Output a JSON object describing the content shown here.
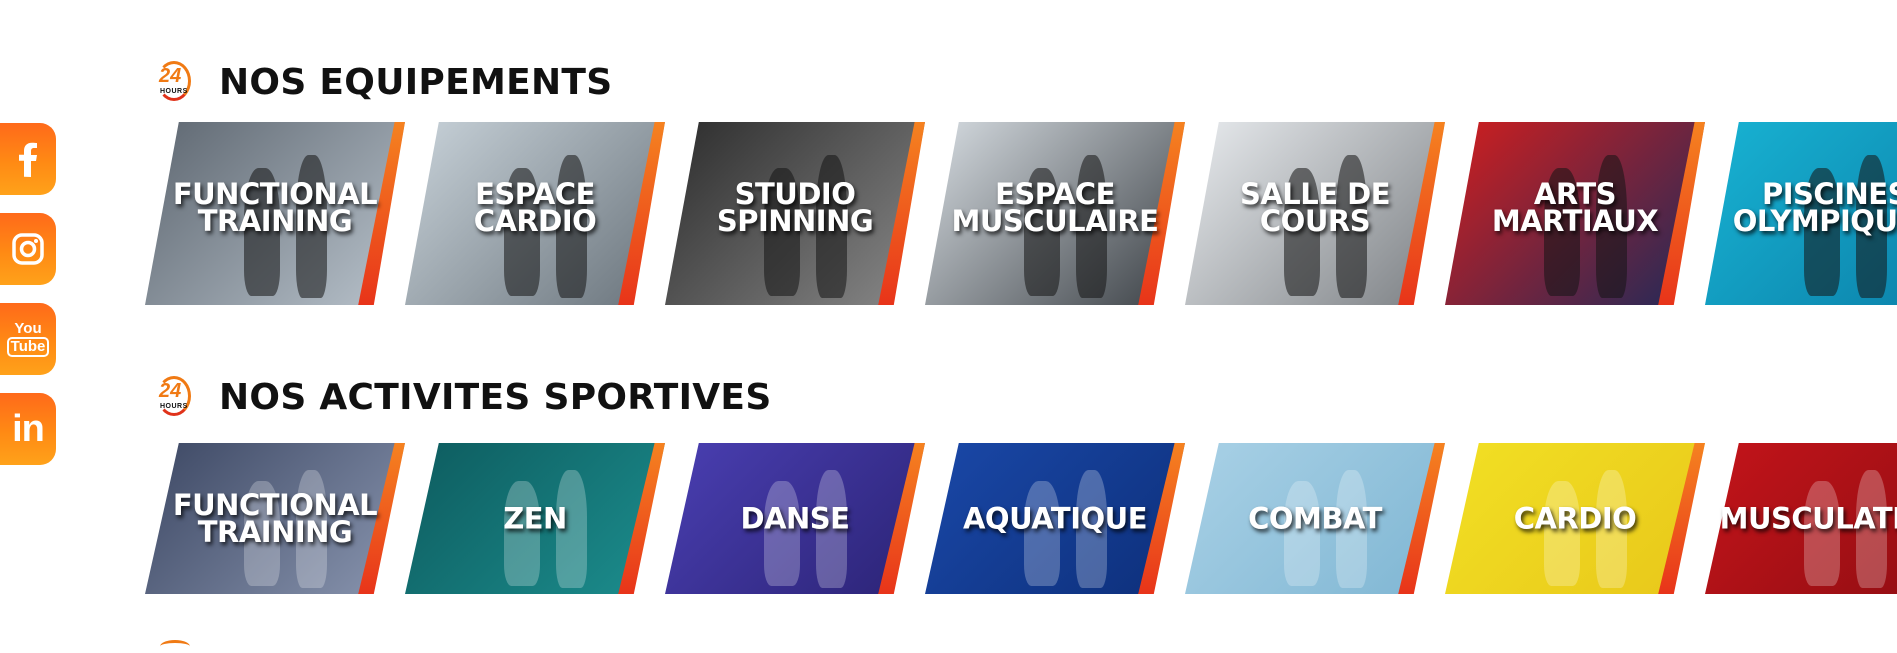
{
  "social": [
    {
      "name": "facebook-icon",
      "glyph": "f"
    },
    {
      "name": "instagram-icon",
      "glyph": ""
    },
    {
      "name": "youtube-icon",
      "glyph_top": "You",
      "glyph_bottom": "Tube"
    },
    {
      "name": "linkedin-icon",
      "glyph": "in"
    }
  ],
  "logo": {
    "number": "24",
    "hours": "HOURS"
  },
  "sections": [
    {
      "title": "NOS EQUIPEMENTS",
      "tiles": [
        {
          "label": "FUNCTIONAL\nTRAINING",
          "bg": "#5d6670",
          "bg2": "#b9c3cc"
        },
        {
          "label": "ESPACE\nCARDIO",
          "bg": "#c9d3da",
          "bg2": "#69737b"
        },
        {
          "label": "STUDIO\nSPINNING",
          "bg": "#2b2b2b",
          "bg2": "#8a8a8a"
        },
        {
          "label": "ESPACE\nMUSCULAIRE",
          "bg": "#d8dee3",
          "bg2": "#3a3f44"
        },
        {
          "label": "SALLE DE\nCOURS",
          "bg": "#e9ecef",
          "bg2": "#7b7f83"
        },
        {
          "label": "ARTS\nMARTIAUX",
          "bg": "#d21e1e",
          "bg2": "#1e2a5a"
        },
        {
          "label": "PISCINES\nOLYMPIQUES",
          "bg": "#18b3d3",
          "bg2": "#0b7fa8"
        }
      ]
    },
    {
      "title": "NOS ACTIVITES SPORTIVES",
      "tiles": [
        {
          "label": "FUNCTIONAL\nTRAINING",
          "bg": "#3c4763",
          "bg2": "#8a96b0"
        },
        {
          "label": "ZEN",
          "bg": "#0d5b5e",
          "bg2": "#1c8e8e"
        },
        {
          "label": "DANSE",
          "bg": "#4a3fb2",
          "bg2": "#2b2375"
        },
        {
          "label": "AQUATIQUE",
          "bg": "#1a48a8",
          "bg2": "#0d2f7a"
        },
        {
          "label": "COMBAT",
          "bg": "#a9d1e6",
          "bg2": "#7fb6d3"
        },
        {
          "label": "CARDIO",
          "bg": "#f2e024",
          "bg2": "#e8c71a"
        },
        {
          "label": "MUSCULATION",
          "bg": "#c4141a",
          "bg2": "#8e0d12"
        }
      ]
    }
  ]
}
